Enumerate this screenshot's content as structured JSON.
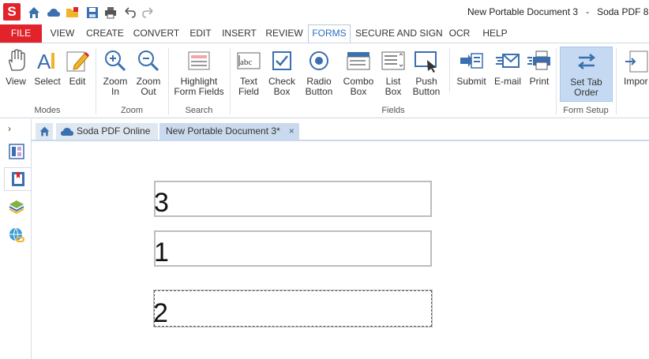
{
  "titlebar": {
    "app_logo": "S",
    "document_title": "New Portable Document 3",
    "separator": "-",
    "app_name": "Soda PDF 8"
  },
  "menu": {
    "file": "FILE",
    "tabs": [
      "VIEW",
      "CREATE",
      "CONVERT",
      "EDIT",
      "INSERT",
      "REVIEW",
      "FORMS",
      "SECURE AND SIGN",
      "OCR",
      "HELP"
    ],
    "active_tab": "FORMS"
  },
  "ribbon": {
    "modes": {
      "view": "View",
      "select": "Select",
      "edit": "Edit",
      "label": "Modes"
    },
    "zoom": {
      "zoom_in": [
        "Zoom",
        "In"
      ],
      "zoom_out": [
        "Zoom",
        "Out"
      ],
      "label": "Zoom"
    },
    "search": {
      "highlight": [
        "Highlight",
        "Form Fields"
      ],
      "label": "Search"
    },
    "fields": {
      "text_field": [
        "Text",
        "Field"
      ],
      "check_box": [
        "Check",
        "Box"
      ],
      "radio_button": [
        "Radio",
        "Button"
      ],
      "combo_box": [
        "Combo",
        "Box"
      ],
      "list_box": [
        "List",
        "Box"
      ],
      "push_button": [
        "Push",
        "Button"
      ],
      "label": "Fields"
    },
    "actions": {
      "submit": "Submit",
      "email": "E-mail",
      "print": "Print"
    },
    "form_setup": {
      "set_tab_order": [
        "Set Tab",
        "Order"
      ],
      "label": "Form Setup"
    },
    "import": "Impor"
  },
  "tabs": {
    "online": "Soda PDF Online",
    "document": "New Portable Document 3*",
    "close_glyph": "×"
  },
  "side": {
    "chevron": "›"
  },
  "form_fields": [
    {
      "value": "3"
    },
    {
      "value": "1"
    },
    {
      "value": "2"
    }
  ],
  "colors": {
    "brand_red": "#e3232b",
    "accent_blue": "#2a6ebb",
    "selected_bg": "#c5daf2"
  }
}
